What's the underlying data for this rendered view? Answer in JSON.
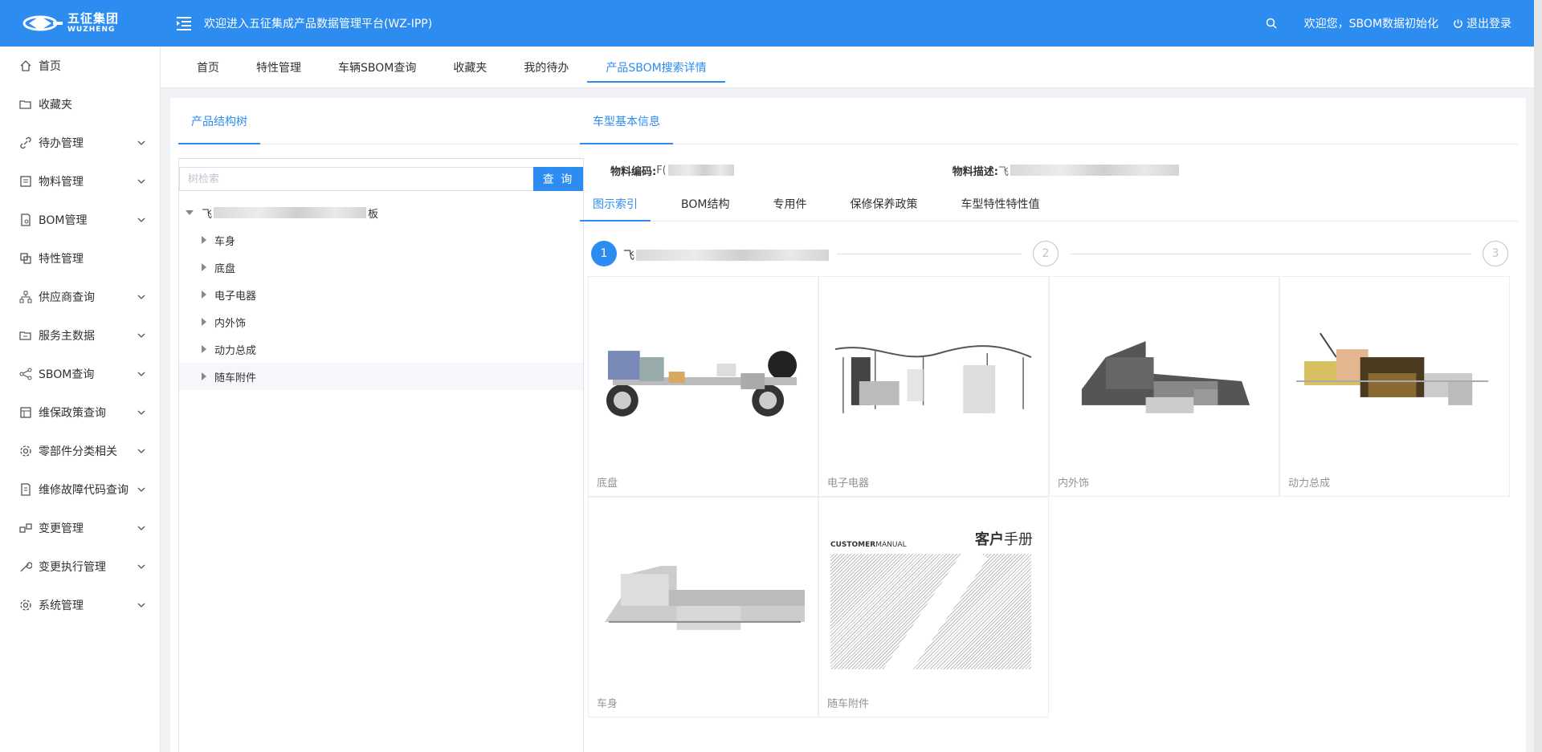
{
  "header": {
    "logo_cn": "五征集团",
    "logo_en": "WUZHENG",
    "title": "欢迎进入五征集成产品数据管理平台(WZ-IPP)",
    "welcome": "欢迎您，SBOM数据初始化",
    "logout": "退出登录"
  },
  "sidebar": {
    "items": [
      {
        "label": "首页",
        "icon": "home-icon"
      },
      {
        "label": "收藏夹",
        "icon": "folder-icon"
      },
      {
        "label": "待办管理",
        "icon": "link-icon"
      },
      {
        "label": "物料管理",
        "icon": "list-icon"
      },
      {
        "label": "BOM管理",
        "icon": "document-icon"
      },
      {
        "label": "特性管理",
        "icon": "copy-icon"
      },
      {
        "label": "供应商查询",
        "icon": "org-icon"
      },
      {
        "label": "服务主数据",
        "icon": "folder-data-icon"
      },
      {
        "label": "SBOM查询",
        "icon": "share-icon"
      },
      {
        "label": "维保政策查询",
        "icon": "table-icon"
      },
      {
        "label": "零部件分类相关",
        "icon": "gear-icon"
      },
      {
        "label": "维修故障代码查询",
        "icon": "report-icon"
      },
      {
        "label": "变更管理",
        "icon": "change-icon"
      },
      {
        "label": "变更执行管理",
        "icon": "wrench-icon"
      },
      {
        "label": "系统管理",
        "icon": "settings-icon"
      }
    ]
  },
  "tabs": [
    "首页",
    "特性管理",
    "车辆SBOM查询",
    "收藏夹",
    "我的待办",
    "产品SBOM搜索详情"
  ],
  "left": {
    "section_title": "产品结构树",
    "search_placeholder": "树检索",
    "search_button": "查 询",
    "root_prefix": "飞",
    "root_suffix": "板",
    "children": [
      "车身",
      "底盘",
      "电子电器",
      "内外饰",
      "动力总成",
      "随车附件"
    ]
  },
  "right": {
    "section_title": "车型基本信息",
    "material_code_label": "物料编码:",
    "material_code_value": "F(",
    "material_desc_label": "物料描述:",
    "material_desc_value": "飞",
    "subtabs": [
      "图示索引",
      "BOM结构",
      "专用件",
      "保修保养政策",
      "车型特性特性值"
    ],
    "steps": [
      "1",
      "2",
      "3"
    ],
    "step1_prefix": "飞",
    "cards": [
      {
        "label": "底盘"
      },
      {
        "label": "电子电器"
      },
      {
        "label": "内外饰"
      },
      {
        "label": "动力总成"
      },
      {
        "label": "车身"
      },
      {
        "label": "随车附件"
      }
    ],
    "manual": {
      "en_bold": "CUSTOMER",
      "en": "MANUAL",
      "cn_bold": "客户",
      "cn": "手册"
    }
  },
  "colors": {
    "primary": "#2d8cf0",
    "header_bg": "#2d8cf0"
  }
}
